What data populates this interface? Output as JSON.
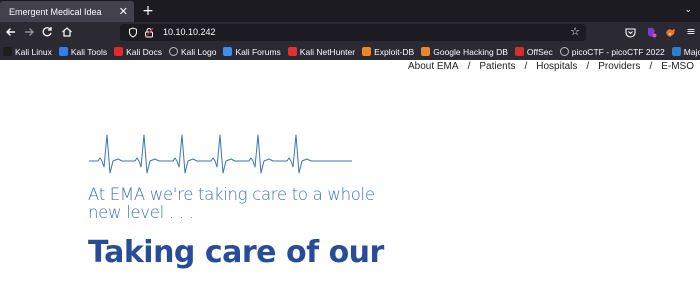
{
  "browser": {
    "tab_title": "Emergent Medical Idea",
    "tab_close_glyph": "✕",
    "new_tab_glyph": "+",
    "list_tabs_glyph": "⌄",
    "url": "10.10.10.242",
    "bookmarks": [
      {
        "label": "Kali Linux",
        "icon": "kali-icon",
        "color": "#1d1d1d"
      },
      {
        "label": "Kali Tools",
        "icon": "kali-tools-icon",
        "color": "#367bf0"
      },
      {
        "label": "Kali Docs",
        "icon": "kali-docs-icon",
        "color": "#e02b2b"
      },
      {
        "label": "Kali Logo",
        "icon": "globe-icon",
        "color": "#bbbbbb"
      },
      {
        "label": "Kali Forums",
        "icon": "kali-forums-icon",
        "color": "#3f8ee8"
      },
      {
        "label": "Kali NetHunter",
        "icon": "nethunter-icon",
        "color": "#e03030"
      },
      {
        "label": "Exploit-DB",
        "icon": "exploit-db-icon",
        "color": "#e9852b"
      },
      {
        "label": "Google Hacking DB",
        "icon": "ghdb-icon",
        "color": "#e9852b"
      },
      {
        "label": "OffSec",
        "icon": "offsec-icon",
        "color": "#d62d2d"
      },
      {
        "label": "picoCTF - picoCTF 2022",
        "icon": "globe-icon",
        "color": "#bbbbbb"
      },
      {
        "label": "Major League Cyber",
        "icon": "mlc-icon",
        "color": "#2b7fd1"
      }
    ]
  },
  "site": {
    "nav": [
      "About EMA",
      "Patients",
      "Hospitals",
      "Providers",
      "E-MSO"
    ],
    "nav_separator": "/",
    "tagline": "At EMA we're taking care to a whole new level . . .",
    "headline": "Taking care of our"
  },
  "colors": {
    "tagline": "#3a74b7",
    "headline": "#274d9a",
    "heartbeat": "#3a74b7"
  }
}
